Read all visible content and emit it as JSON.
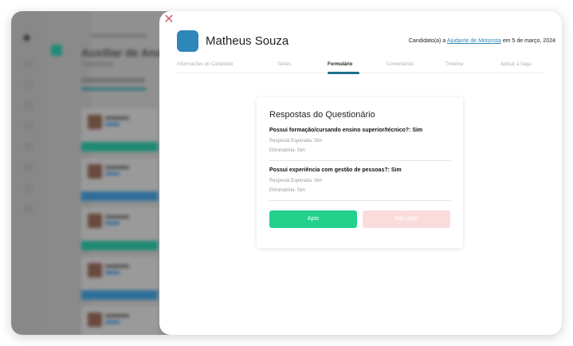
{
  "candidate": {
    "name": "Matheus Souza",
    "meta_prefix": "Candidato(a) a",
    "job_link": "Ajudante de Motorista",
    "meta_suffix": "em 5 de março, 2024",
    "avatar_color": "#2f86b8"
  },
  "tabs": [
    {
      "label": "Informações do Candidato",
      "active": false
    },
    {
      "label": "Testes",
      "active": false
    },
    {
      "label": "Formulário",
      "active": true
    },
    {
      "label": "Comentários",
      "active": false
    },
    {
      "label": "Timeline",
      "active": false
    },
    {
      "label": "Aplicar à Vaga",
      "active": false
    }
  ],
  "questionnaire": {
    "title": "Respostas do Questionário",
    "questions": [
      {
        "question": "Possui formação/cursando ensino superior/técnico?: Sim",
        "expected": "Resposta Esperada: Sim",
        "eliminatory": "Eliminatória: Sim"
      },
      {
        "question": "Possui experiência com gestão de pessoas?: Sim",
        "expected": "Resposta Esperada: Sim",
        "eliminatory": "Eliminatória: Sim"
      }
    ],
    "approve_label": "Apto",
    "reject_label": "Não Apto"
  },
  "background": {
    "page_title": "Auxiliar de Anal",
    "close_symbol": "✕"
  },
  "colors": {
    "accent": "#1e6f8a",
    "approve": "#23d08c",
    "reject": "#fadcdc",
    "close": "#d0646c"
  }
}
